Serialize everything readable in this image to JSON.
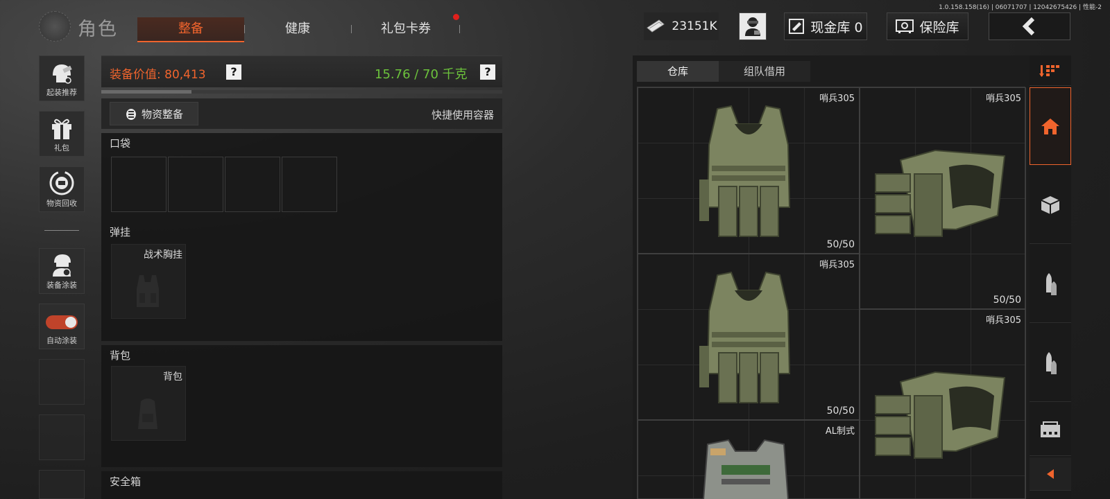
{
  "version": "1.0.158.158(16) | 06071707 | 12042675426 | 性能-2",
  "header": {
    "title": "角色",
    "tabs": [
      {
        "label": "整备",
        "active": true
      },
      {
        "label": "健康",
        "active": false
      },
      {
        "label": "礼包卡券",
        "active": false,
        "notification": true
      }
    ],
    "money": "23151K",
    "cash_vault": "现金库 0",
    "insurance_vault": "保险库"
  },
  "sidebar": {
    "items": [
      {
        "label": "起装推荐",
        "icon": "helmet-recommend-icon"
      },
      {
        "label": "礼包",
        "icon": "gift-icon"
      },
      {
        "label": "物资回收",
        "icon": "recycle-icon"
      },
      {
        "label": "装备涂装",
        "icon": "operator-paint-icon"
      },
      {
        "label": "自动涂装",
        "icon": "toggle-switch",
        "toggle_on": true
      }
    ]
  },
  "loadout": {
    "value_label": "装备价值: 80,413",
    "weight_label": "15.76 / 70 千克",
    "weight_fraction": 0.225,
    "help": "?",
    "supply_button": "物资整备",
    "quick_use": "快捷使用容器",
    "sections": {
      "pocket": {
        "title": "口袋",
        "slots": 4
      },
      "chest_rig": {
        "title": "弹挂",
        "slot_label": "战术胸挂"
      },
      "backpack": {
        "title": "背包",
        "slot_label": "背包"
      },
      "safe_box": {
        "title": "安全箱"
      }
    }
  },
  "inventory": {
    "tabs": [
      {
        "label": "仓库",
        "active": true
      },
      {
        "label": "组队借用",
        "active": false
      }
    ],
    "items": [
      {
        "name": "哨兵305",
        "count": "50/50",
        "type": "vest-front"
      },
      {
        "name": "哨兵305",
        "count": "50/50",
        "type": "vest-side"
      },
      {
        "name": "哨兵305",
        "count": "50/50",
        "type": "vest-front"
      },
      {
        "name": "哨兵305",
        "count": "",
        "type": "vest-side"
      },
      {
        "name": "AL制式",
        "count": "",
        "type": "vest-al"
      }
    ]
  },
  "rail": {
    "items": [
      "sort-icon",
      "home-icon",
      "box-icon",
      "ammo-icon",
      "ammo-icon",
      "container-icon",
      "collapse-icon"
    ]
  },
  "colors": {
    "accent": "#f0642d",
    "weight_ok": "#6cc23c",
    "notification": "#e0201c"
  }
}
